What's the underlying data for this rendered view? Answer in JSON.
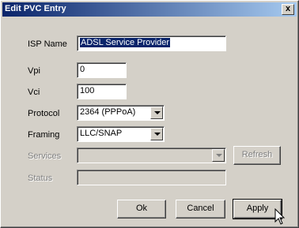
{
  "window": {
    "title": "Edit PVC Entry",
    "close_glyph": "x"
  },
  "form": {
    "isp_name": {
      "label": "ISP Name",
      "value": "ADSL Service Provider"
    },
    "vpi": {
      "label": "Vpi",
      "value": "0"
    },
    "vci": {
      "label": "Vci",
      "value": "100"
    },
    "protocol": {
      "label": "Protocol",
      "value": "2364 (PPPoA)"
    },
    "framing": {
      "label": "Framing",
      "value": "LLC/SNAP"
    },
    "services": {
      "label": "Services",
      "value": ""
    },
    "status": {
      "label": "Status",
      "value": ""
    }
  },
  "buttons": {
    "refresh": "Refresh",
    "ok": "Ok",
    "cancel": "Cancel",
    "apply": "Apply"
  },
  "colors": {
    "titlebar_start": "#0a246a",
    "titlebar_end": "#a6caf0",
    "dialog_face": "#d4d0c8"
  }
}
